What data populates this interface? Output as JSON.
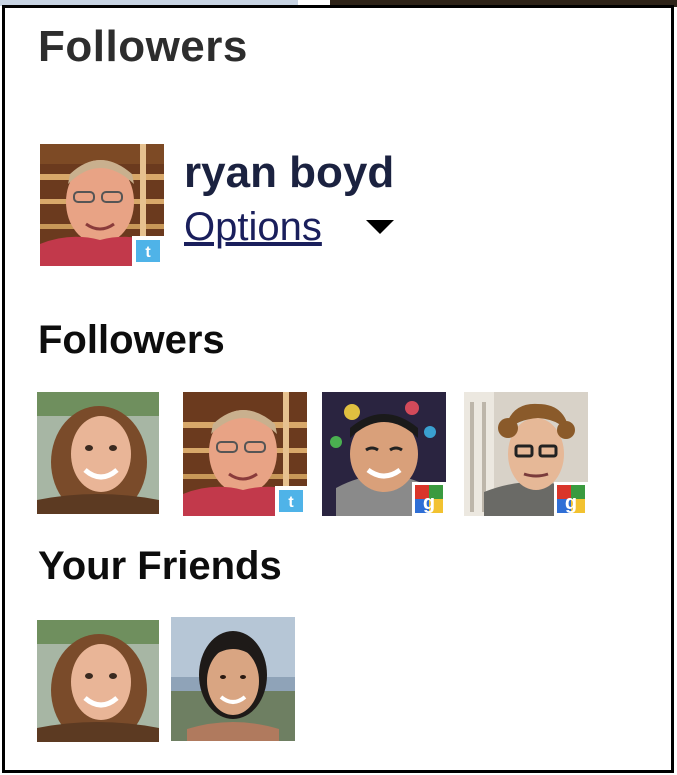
{
  "gadget": {
    "title": "Followers"
  },
  "profile": {
    "name": "ryan boyd",
    "options_label": "Options",
    "badge": "twitter"
  },
  "followers_section": {
    "title": "Followers",
    "avatars": [
      {
        "badge": "none"
      },
      {
        "badge": "twitter"
      },
      {
        "badge": "google"
      },
      {
        "badge": "google"
      }
    ]
  },
  "friends_section": {
    "title": "Your Friends",
    "avatars": [
      {
        "badge": "none"
      },
      {
        "badge": "none"
      }
    ]
  },
  "colors": {
    "twitter_badge": "#4fb3e8",
    "google_red": "#d9352a",
    "google_green": "#3a9a3f",
    "google_blue": "#2f6fd6",
    "link": "#1a1f5c"
  }
}
